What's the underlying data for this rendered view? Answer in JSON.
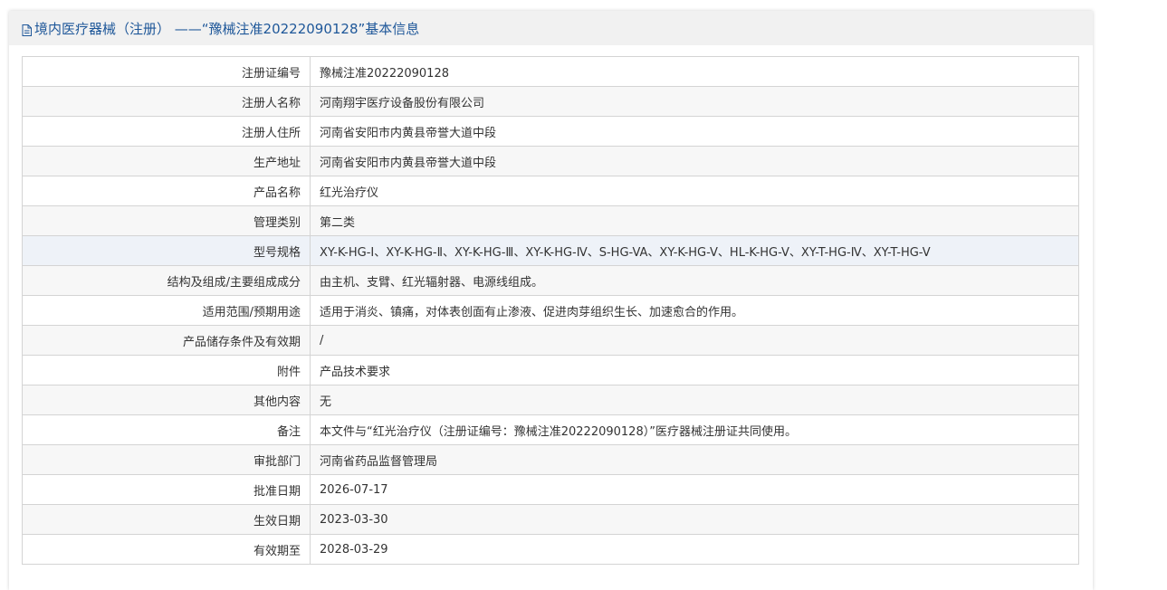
{
  "header": {
    "title": "境内医疗器械（注册） ——“豫械注准20222090128”基本信息",
    "icon": "document-icon"
  },
  "rows": [
    {
      "label": "注册证编号",
      "value": "豫械注准20222090128"
    },
    {
      "label": "注册人名称",
      "value": "河南翔宇医疗设备股份有限公司"
    },
    {
      "label": "注册人住所",
      "value": "河南省安阳市内黄县帝誉大道中段"
    },
    {
      "label": "生产地址",
      "value": "河南省安阳市内黄县帝誉大道中段"
    },
    {
      "label": "产品名称",
      "value": "红光治疗仪"
    },
    {
      "label": "管理类别",
      "value": "第二类"
    },
    {
      "label": "型号规格",
      "value": "XY-K-HG-Ⅰ、XY-K-HG-Ⅱ、XY-K-HG-Ⅲ、XY-K-HG-Ⅳ、S-HG-VA、XY-K-HG-V、HL-K-HG-V、XY-T-HG-Ⅳ、XY-T-HG-V"
    },
    {
      "label": "结构及组成/主要组成成分",
      "value": "由主机、支臂、红光辐射器、电源线组成。"
    },
    {
      "label": "适用范围/预期用途",
      "value": "适用于消炎、镇痛，对体表创面有止渗液、促进肉芽组织生长、加速愈合的作用。"
    },
    {
      "label": "产品储存条件及有效期",
      "value": "/"
    },
    {
      "label": "附件",
      "value": "产品技术要求"
    },
    {
      "label": "其他内容",
      "value": "无"
    },
    {
      "label": "备注",
      "value": "本文件与“红光治疗仪（注册证编号：豫械注准20222090128）”医疗器械注册证共同使用。"
    },
    {
      "label": "审批部门",
      "value": "河南省药品监督管理局"
    },
    {
      "label": "批准日期",
      "value": "2026-07-17"
    },
    {
      "label": "生效日期",
      "value": "2023-03-30"
    },
    {
      "label": "有效期至",
      "value": "2028-03-29"
    }
  ],
  "colors": {
    "title": "#1e5799",
    "header_bg": "#f1f1f1",
    "border": "#d4d4d4",
    "row_alt": "#f7f7f7",
    "row_highlight": "#eef2f8"
  }
}
